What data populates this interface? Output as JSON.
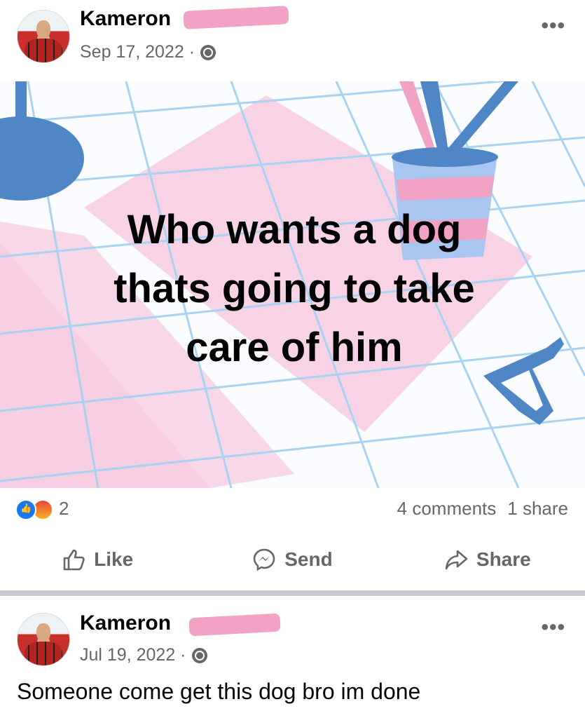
{
  "posts": [
    {
      "author": "Kameron",
      "date": "Sep 17, 2022 ·",
      "more_label": "•••",
      "image_text": "Who wants a dog\nthats going to take\ncare of him",
      "reaction_count": "2",
      "comments": "4 comments",
      "shares": "1 share",
      "actions": {
        "like": "Like",
        "send": "Send",
        "share": "Share"
      }
    },
    {
      "author": "Kameron",
      "date": "Jul 19, 2022 ·",
      "more_label": "•••",
      "text": "Someone come get this dog bro im done"
    }
  ],
  "colors": {
    "like_blue": "#1877f2",
    "meta_gray": "#65676b",
    "redaction_pink": "#f2a2c4"
  },
  "icons": [
    "globe-icon",
    "like-reaction-icon",
    "angry-reaction-icon",
    "thumbs-up-icon",
    "messenger-icon",
    "share-arrow-icon",
    "more-options-icon"
  ]
}
